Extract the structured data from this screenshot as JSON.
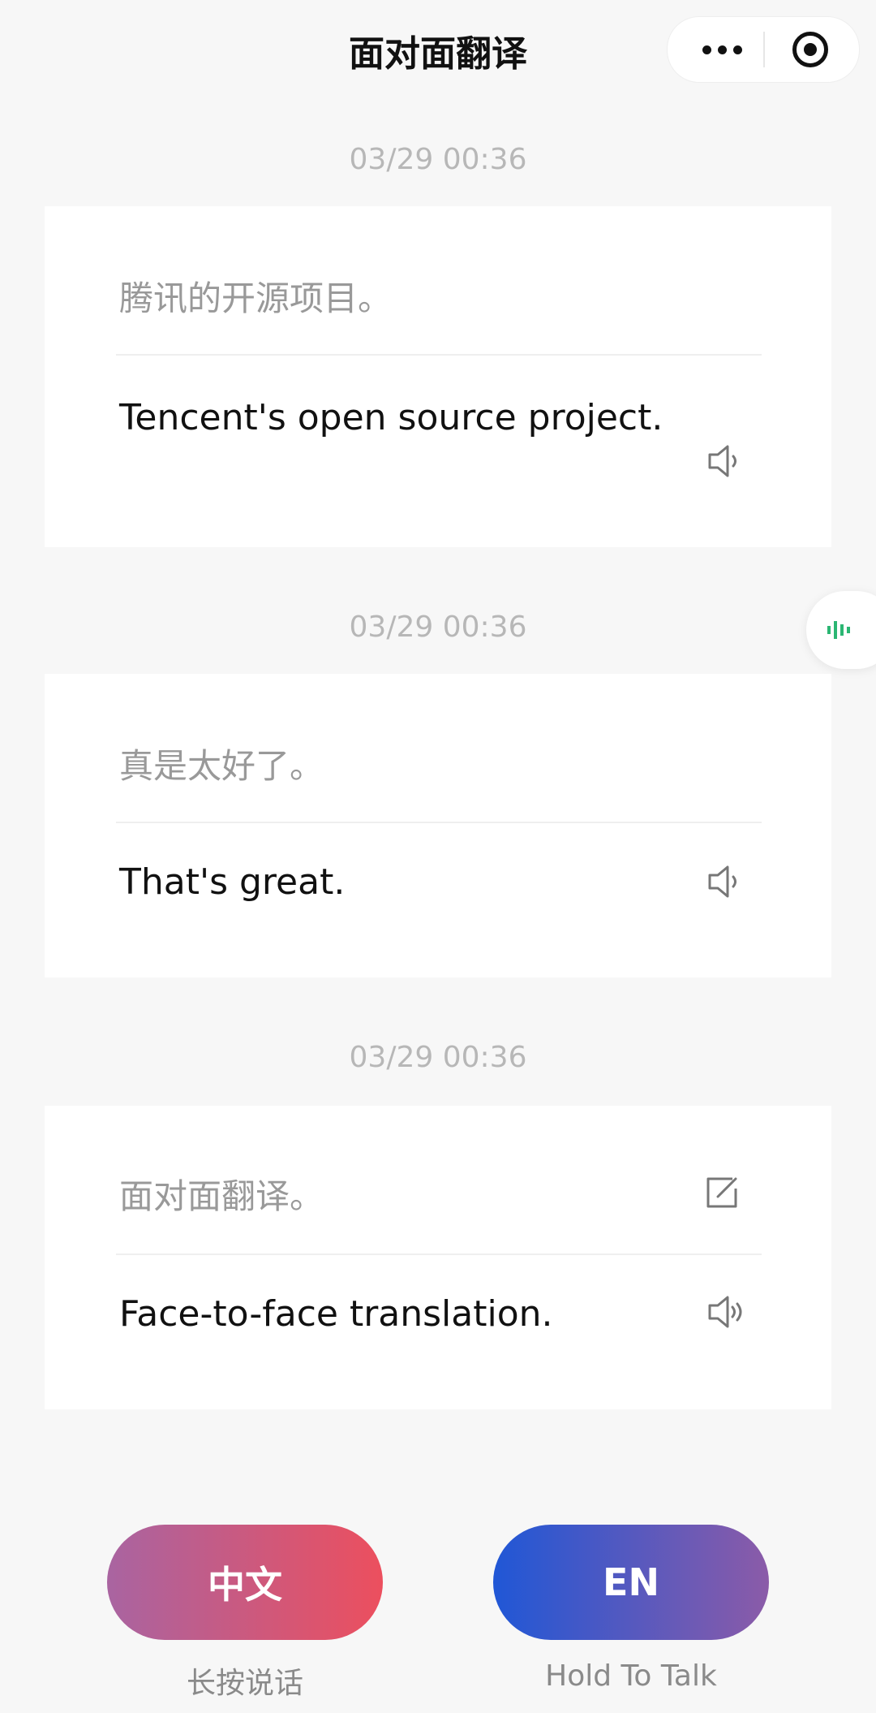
{
  "header": {
    "title": "面对面翻译"
  },
  "messages": [
    {
      "timestamp": "03/29 00:36",
      "source": "腾讯的开源项目。",
      "target": "Tencent's open source project."
    },
    {
      "timestamp": "03/29 00:36",
      "source": "真是太好了。",
      "target": "That's great."
    },
    {
      "timestamp": "03/29 00:36",
      "source": "面对面翻译。",
      "target": "Face-to-face translation."
    }
  ],
  "buttons": {
    "zh_label": "中文",
    "en_label": "EN",
    "zh_hint": "长按说话",
    "en_hint": "Hold To Talk"
  },
  "icons": {
    "capsule": [
      "more-icon",
      "target-icon"
    ],
    "card": [
      "speaker-icon",
      "edit-icon"
    ],
    "floating": "waveform-icon"
  },
  "colors": {
    "accent_green": "#2bb673",
    "zh_gradient": [
      "#a964a1",
      "#ec4f5e"
    ],
    "en_gradient": [
      "#2057d6",
      "#8b5ba8"
    ]
  }
}
